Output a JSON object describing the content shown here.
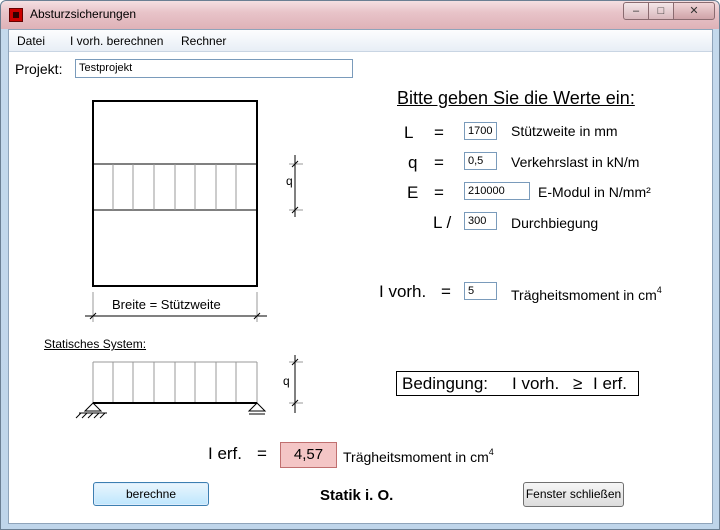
{
  "window": {
    "title": "Absturzsicherungen",
    "min": "0",
    "max": "1",
    "close": "r"
  },
  "menu": [
    "Datei",
    "I vorh. berechnen",
    "Rechner"
  ],
  "projekt": {
    "label": "Projekt:",
    "value": "Testprojekt"
  },
  "heading": "Bitte geben Sie die Werte ein:",
  "fields": [
    {
      "symbol": "L",
      "eq": "=",
      "value": "1700",
      "desc": "Stützweite in mm"
    },
    {
      "symbol": "q",
      "eq": "=",
      "value": "0,5",
      "desc": "Verkehrslast in kN/m"
    },
    {
      "symbol": "E",
      "eq": "=",
      "value": "210000",
      "desc": "E-Modul in N/mm²"
    },
    {
      "symbol": "L /",
      "eq": "",
      "value": "300",
      "desc": "Durchbiegung"
    }
  ],
  "ivorh": {
    "symbol": "I vorh.",
    "eq": "=",
    "value": "5",
    "desc": "Trägheitsmoment in cm",
    "exp": "4"
  },
  "diagram": {
    "q": "q",
    "breite": "Breite = Stützweite",
    "system_label": "Statisches System:",
    "q2": "q"
  },
  "bedingung": {
    "text": "Bedingung:",
    "left": "I vorh.",
    "op": "≥",
    "right": "I erf."
  },
  "ierf": {
    "symbol": "I erf.",
    "eq": "=",
    "value": "4,57",
    "desc": "Trägheitsmoment in cm",
    "exp": "4"
  },
  "buttons": {
    "berechne": "berechne",
    "close": "Fenster schließen"
  },
  "status": "Statik i. O.",
  "colors": {
    "result_bg": "#f4c6c6",
    "result_border": "#c07070"
  }
}
